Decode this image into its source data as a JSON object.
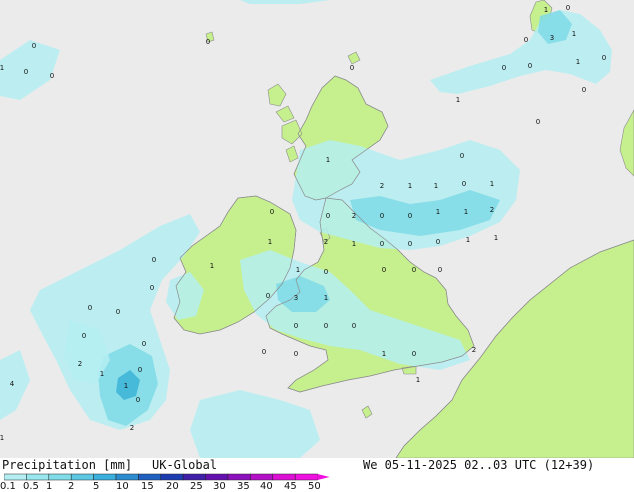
{
  "map": {
    "colors": {
      "sea": "#ebebeb",
      "land": "#c6f08e",
      "coast": "#8c8c8c",
      "precip_light": "#b4eef2",
      "precip_medium": "#7fdbe6",
      "precip_heavy": "#3db4d6"
    },
    "labels": [
      "1",
      "3",
      "1",
      "0",
      "0",
      "0",
      "0",
      "1",
      "0",
      "0",
      "0",
      "0",
      "1",
      "0",
      "0",
      "0",
      "1",
      "0",
      "1",
      "0",
      "2",
      "1",
      "1",
      "0",
      "1",
      "0",
      "0",
      "2",
      "0",
      "0",
      "1",
      "1",
      "2",
      "1",
      "2",
      "1",
      "0",
      "0",
      "0",
      "1",
      "1",
      "1",
      "1",
      "0",
      "0",
      "0",
      "0",
      "0",
      "0",
      "0",
      "3",
      "1",
      "0",
      "0",
      "0",
      "0",
      "0",
      "0",
      "0",
      "0",
      "0",
      "1",
      "0",
      "2",
      "2",
      "0",
      "1",
      "4",
      "1",
      "0",
      "1",
      "1",
      "2"
    ]
  },
  "footer": {
    "title": "Precipitation [mm]",
    "model": "UK-Global",
    "datetime": "We 05-11-2025 02..03 UTC (12+39)"
  },
  "legend": {
    "ticks": [
      "0.1",
      "0.5",
      "1",
      "2",
      "5",
      "10",
      "15",
      "20",
      "25",
      "30",
      "35",
      "40",
      "45",
      "50"
    ],
    "colors": [
      "#b4eef2",
      "#9ae6ee",
      "#80dce8",
      "#5cc8e4",
      "#3cb0dc",
      "#2c8cd0",
      "#2060c0",
      "#1c3cb0",
      "#4020a8",
      "#6410b0",
      "#8c10bc",
      "#b410c8",
      "#dc10d4",
      "#f010e0"
    ]
  }
}
